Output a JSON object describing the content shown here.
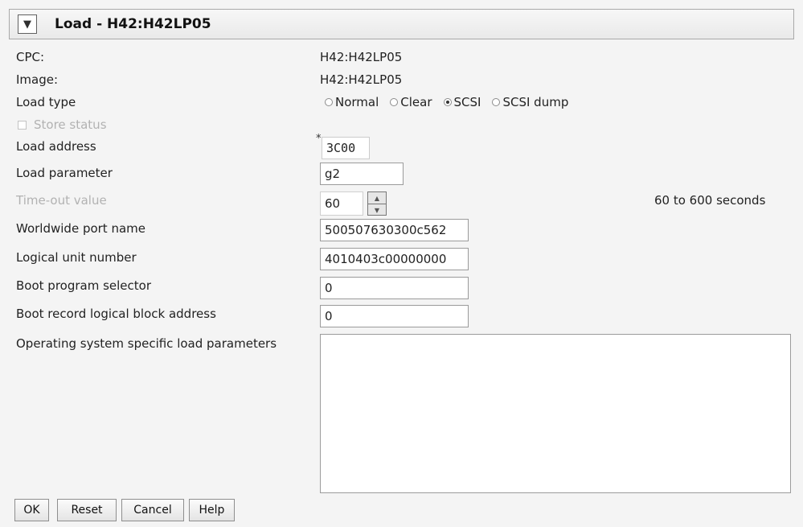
{
  "title": {
    "toggle_icon": "collapse-arrow-icon",
    "text": "Load - H42:H42LP05"
  },
  "fields": {
    "cpc": {
      "label": "CPC:",
      "value": "H42:H42LP05"
    },
    "image": {
      "label": "Image:",
      "value": "H42:H42LP05"
    },
    "load_type": {
      "label": "Load type",
      "options": [
        {
          "label": "Normal",
          "selected": false
        },
        {
          "label": "Clear",
          "selected": false
        },
        {
          "label": "SCSI",
          "selected": true
        },
        {
          "label": "SCSI dump",
          "selected": false
        }
      ]
    },
    "store_status": {
      "label": "Store status",
      "checked": false,
      "disabled": true
    },
    "load_address": {
      "label": "Load address",
      "required_marker": "*",
      "value": "3C00"
    },
    "load_parameter": {
      "label": "Load parameter",
      "value": "g2"
    },
    "timeout": {
      "label": "Time-out value",
      "value": "60",
      "hint": "60 to 600 seconds",
      "disabled": true
    },
    "wwpn": {
      "label": "Worldwide port name",
      "value": "500507630300c562"
    },
    "lun": {
      "label": "Logical unit number",
      "value": "4010403c00000000"
    },
    "boot_program_selector": {
      "label": "Boot program selector",
      "value": "0"
    },
    "boot_record_lba": {
      "label": "Boot record logical block address",
      "value": "0"
    },
    "os_load_params": {
      "label": "Operating system specific load parameters",
      "value": ""
    }
  },
  "buttons": {
    "ok": "OK",
    "reset": "Reset",
    "cancel": "Cancel",
    "help": "Help"
  }
}
